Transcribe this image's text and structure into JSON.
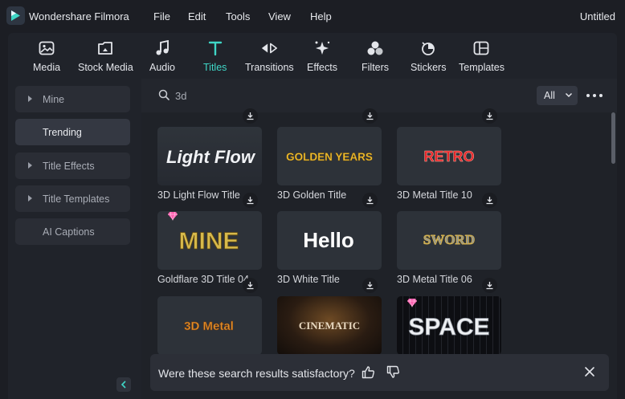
{
  "app": {
    "name": "Wondershare Filmora",
    "document_title": "Untitled",
    "menu": [
      "File",
      "Edit",
      "Tools",
      "View",
      "Help"
    ]
  },
  "toolbar": {
    "tabs": [
      {
        "label": "Media",
        "icon": "media-icon"
      },
      {
        "label": "Stock Media",
        "icon": "stock-media-icon"
      },
      {
        "label": "Audio",
        "icon": "music-note-icon"
      },
      {
        "label": "Titles",
        "icon": "titles-t-icon",
        "active": true
      },
      {
        "label": "Transitions",
        "icon": "transitions-icon"
      },
      {
        "label": "Effects",
        "icon": "effects-sparkle-icon"
      },
      {
        "label": "Filters",
        "icon": "filters-icon"
      },
      {
        "label": "Stickers",
        "icon": "stickers-icon"
      },
      {
        "label": "Templates",
        "icon": "templates-icon"
      }
    ],
    "active_color": "#3fd6c6"
  },
  "sidebar": {
    "items": [
      {
        "label": "Mine",
        "expandable": true
      },
      {
        "label": "Trending",
        "active": true
      },
      {
        "label": "Title Effects",
        "expandable": true
      },
      {
        "label": "Title Templates",
        "expandable": true
      },
      {
        "label": "AI Captions"
      }
    ]
  },
  "search": {
    "value": "3d",
    "filter": "All"
  },
  "results": [
    {
      "title": "3D Light Flow Title",
      "thumb_text": "Light Flow",
      "premium": false
    },
    {
      "title": "3D Golden Title",
      "thumb_text": "GOLDEN YEARS",
      "premium": false
    },
    {
      "title": "3D Metal Title 10",
      "thumb_text": "RETRO",
      "premium": false
    },
    {
      "title": "Goldflare 3D Title 04",
      "thumb_text": "MINE",
      "premium": true
    },
    {
      "title": "3D White Title",
      "thumb_text": "Hello",
      "premium": false
    },
    {
      "title": "3D Metal Title 06",
      "thumb_text": "SWORD",
      "premium": false
    },
    {
      "title": "",
      "thumb_text": "3D Metal",
      "premium": false
    },
    {
      "title": "",
      "thumb_text": "CINEMATIC",
      "premium": false
    },
    {
      "title": "",
      "thumb_text": "SPACE",
      "premium": true
    }
  ],
  "feedback": {
    "question": "Were these search results satisfactory?"
  },
  "colors": {
    "accent": "#3fd6c6",
    "premium_gem": "#ff5fb0"
  }
}
